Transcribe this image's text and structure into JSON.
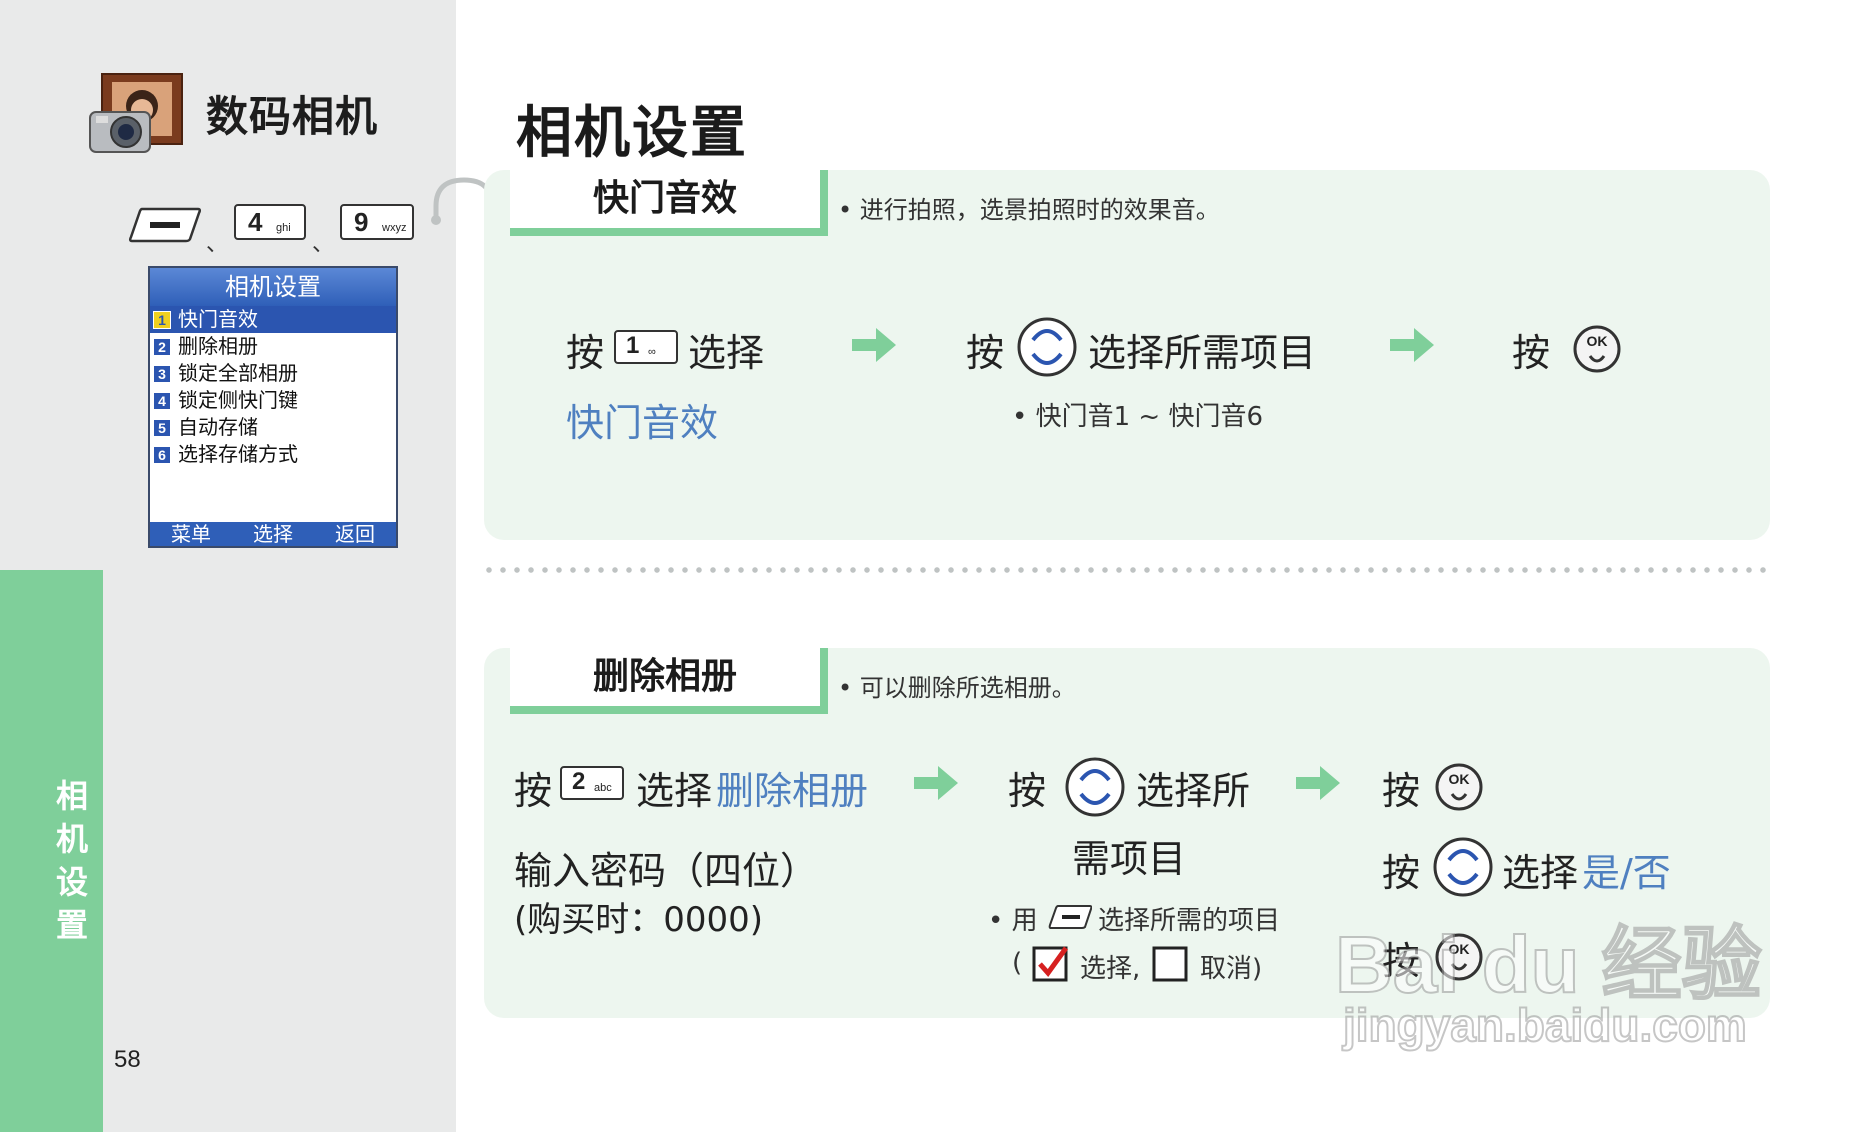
{
  "sidebar": {
    "app_title": "数码相机",
    "keys": [
      {
        "num": "4",
        "sub": "ghi"
      },
      {
        "num": "9",
        "sub": "wxyz"
      }
    ],
    "separator": "、",
    "tab_label": "相机设置",
    "page_number": "58"
  },
  "phone_screen": {
    "title": "相机设置",
    "items": [
      {
        "num": "1",
        "label": "快门音效"
      },
      {
        "num": "2",
        "label": "删除相册"
      },
      {
        "num": "3",
        "label": "锁定全部相册"
      },
      {
        "num": "4",
        "label": "锁定侧快门键"
      },
      {
        "num": "5",
        "label": "自动存储"
      },
      {
        "num": "6",
        "label": "选择存储方式"
      }
    ],
    "softkeys": [
      "菜单",
      "选择",
      "返回"
    ]
  },
  "main": {
    "title": "相机设置",
    "section1": {
      "title": "快门音效",
      "desc": "• 进行拍照，选景拍照时的效果音。",
      "step1_press": "按",
      "step1_key": {
        "num": "1",
        "sub": "∞"
      },
      "step1_select": "选择",
      "step1_target": "快门音效",
      "step2_press": "按",
      "step2_text": "选择所需项目",
      "step2_note": "•  快门音1 ~ 快门音6",
      "step3_press": "按",
      "ok_label": "OK"
    },
    "section2": {
      "title": "删除相册",
      "desc": "• 可以删除所选相册。",
      "step1_press": "按",
      "step1_key": {
        "num": "2",
        "sub": "abc"
      },
      "step1_select": "选择",
      "step1_target": "删除相册",
      "step1_line2": "输入密码（四位）",
      "step1_line3": "(购买时：0000)",
      "step2_press": "按",
      "step2_text_a": "选择所",
      "step2_text_b": "需项目",
      "step2_note_a": "•  用",
      "step2_note_b": "选择所需的项目",
      "step2_note_c1": "(",
      "step2_note_c2": "选择,",
      "step2_note_c3": "取消)",
      "step3a_press": "按",
      "step3b_press": "按",
      "step3b_select": "选择",
      "step3b_target": "是/否",
      "step3c_press": "按",
      "ok_label": "OK"
    }
  },
  "watermark": {
    "brand": "Bai du 经验",
    "url": "jingyan.baidu.com"
  },
  "colors": {
    "accent_green": "#7fcf9a",
    "panel_bg": "#edf6ef",
    "sidebar_bg": "#e9eaea",
    "link_blue": "#4f80c0",
    "screen_blue": "#2b55b0"
  }
}
